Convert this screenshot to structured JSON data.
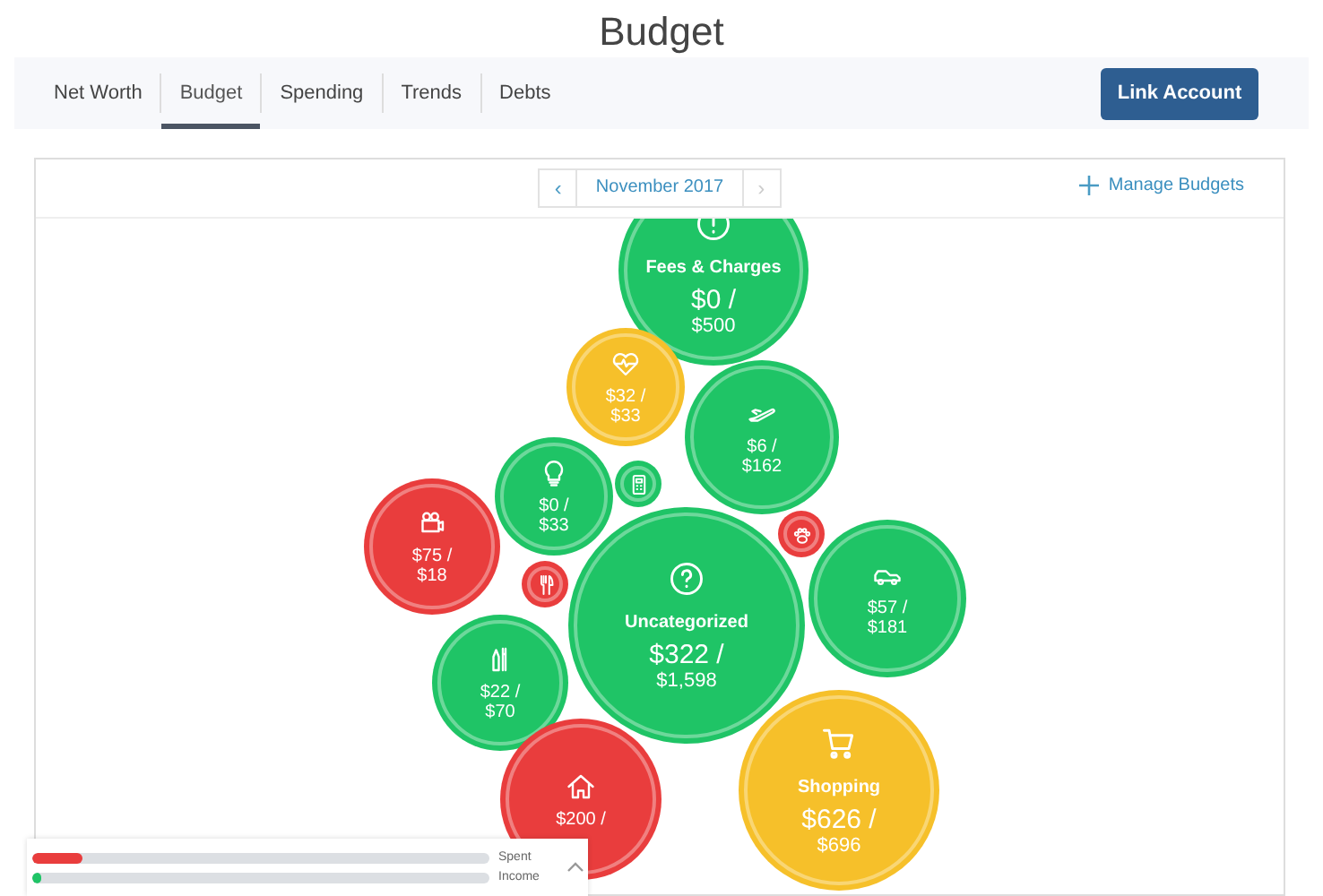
{
  "page": {
    "title": "Budget"
  },
  "tabs": [
    {
      "label": "Net Worth",
      "selected": false
    },
    {
      "label": "Budget",
      "selected": true
    },
    {
      "label": "Spending",
      "selected": false
    },
    {
      "label": "Trends",
      "selected": false
    },
    {
      "label": "Debts",
      "selected": false
    }
  ],
  "link_button": "Link Account",
  "month_picker": {
    "prev": "‹",
    "month": "November 2017",
    "next": "›",
    "next_disabled": true
  },
  "manage_link": "Manage Budgets",
  "bubbles": [
    {
      "color": "#1fc466",
      "label": "Fees & Charges",
      "spent": "$0 /",
      "budget": "$500"
    },
    {
      "color": "#f6c02a",
      "spent": "$32 /",
      "budget": "$33"
    },
    {
      "color": "#1fc466",
      "spent": "$6 /",
      "budget": "$162"
    },
    {
      "color": "#1fc466",
      "spent": "$0 /",
      "budget": "$33"
    },
    {
      "color": "#1fc466"
    },
    {
      "color": "#e93d3d",
      "spent": "$75 /",
      "budget": "$18"
    },
    {
      "color": "#e93d3d"
    },
    {
      "color": "#e93d3d"
    },
    {
      "color": "#1fc466",
      "label": "Uncategorized",
      "spent": "$322 /",
      "budget": "$1,598"
    },
    {
      "color": "#1fc466",
      "spent": "$57 /",
      "budget": "$181"
    },
    {
      "color": "#1fc466",
      "spent": "$22 /",
      "budget": "$70"
    },
    {
      "color": "#e93d3d",
      "spent": "$200 /"
    },
    {
      "color": "#f6c02a",
      "label": "Shopping",
      "spent": "$626 /",
      "budget": "$696"
    }
  ],
  "summary": [
    {
      "kind": "spent",
      "label": "Spent",
      "level": 0.11
    },
    {
      "kind": "income",
      "label": "Income",
      "level": 0.02
    }
  ]
}
